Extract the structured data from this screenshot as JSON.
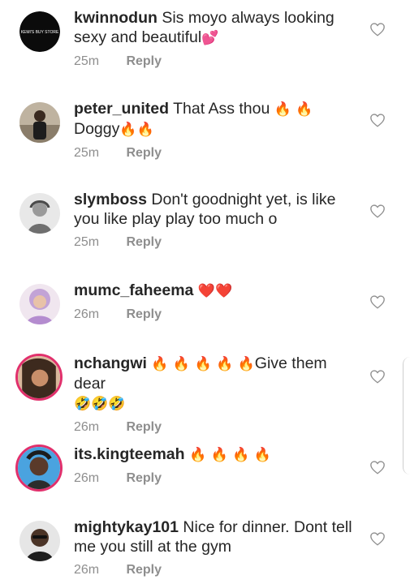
{
  "comments": [
    {
      "username": "kwinnodun",
      "text": "Sis moyo always looking sexy and beautiful",
      "emoji": "💕",
      "time": "25m",
      "reply": "Reply",
      "avatar": "brand-logo",
      "avatar_text": "KEMI'S BUY STORE",
      "story_ring": false
    },
    {
      "username": "peter_united",
      "text": "That Ass thou",
      "emoji": "🔥 🔥",
      "text2": "Doggy",
      "emoji2": "🔥🔥",
      "time": "25m",
      "reply": "Reply",
      "avatar": "person-photo",
      "story_ring": false
    },
    {
      "username": "slymboss",
      "text": "Don't goodnight yet, is like you like play play too much o",
      "time": "25m",
      "reply": "Reply",
      "avatar": "person-photo-gray",
      "story_ring": false
    },
    {
      "username": "mumc_faheema",
      "emoji": "❤️❤️",
      "time": "26m",
      "reply": "Reply",
      "avatar": "person-photo",
      "story_ring": false
    },
    {
      "username": "nchangwi",
      "emoji": "🔥 🔥 🔥 🔥 🔥",
      "text": "Give them dear",
      "emoji2": "🤣🤣🤣",
      "time": "26m",
      "reply": "Reply",
      "avatar": "person-photo",
      "story_ring": true
    },
    {
      "username": "its.kingteemah",
      "emoji": "🔥 🔥 🔥 🔥",
      "time": "26m",
      "reply": "Reply",
      "avatar": "person-photo",
      "story_ring": true
    },
    {
      "username": "mightykay101",
      "text": "Nice for dinner. Dont tell me you still at the gym",
      "time": "26m",
      "reply": "Reply",
      "avatar": "person-photo",
      "story_ring": false
    }
  ],
  "icons": {
    "like": "heart-outline-icon"
  },
  "colors": {
    "text": "#262626",
    "muted": "#8e8e8e",
    "story_ring": "#e1306c",
    "fire": "#f5a623"
  }
}
